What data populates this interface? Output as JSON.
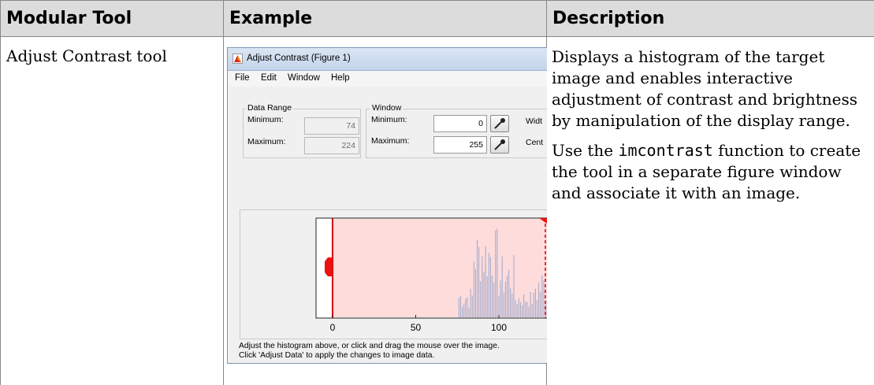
{
  "table": {
    "headers": [
      "Modular Tool",
      "Example",
      "Description"
    ],
    "row": {
      "tool": "Adjust Contrast tool",
      "description_p1": "Displays a histogram of the target image and enables interactive adjustment of contrast and brightness by manipulation of the display range.",
      "description_p2_before": "Use the ",
      "description_p2_code": "imcontrast",
      "description_p2_after": " function to create the tool in a separate figure window and associate it with an image."
    }
  },
  "example_window": {
    "title": "Adjust Contrast (Figure 1)",
    "menu": [
      "File",
      "Edit",
      "Window",
      "Help"
    ],
    "data_range": {
      "label": "Data Range",
      "min_label": "Minimum:",
      "min_value": "74",
      "max_label": "Maximum:",
      "max_value": "224"
    },
    "window_group": {
      "label": "Window",
      "min_label": "Minimum:",
      "min_value": "0",
      "max_label": "Maximum:",
      "max_value": "255",
      "width_label": "Widt",
      "center_label": "Cent"
    },
    "axis_ticks": [
      "0",
      "50",
      "100"
    ],
    "footer_line1": "Adjust the histogram above, or click and drag the mouse over the image.",
    "footer_line2": "Click 'Adjust Data' to apply the changes to image data.",
    "icons": {
      "title": "matlab-figure-icon",
      "picker": "eyedropper-icon"
    },
    "colors": {
      "window_fill": "#ffdcdc",
      "window_line": "#d40000",
      "histogram": "#9aa8cc"
    }
  }
}
